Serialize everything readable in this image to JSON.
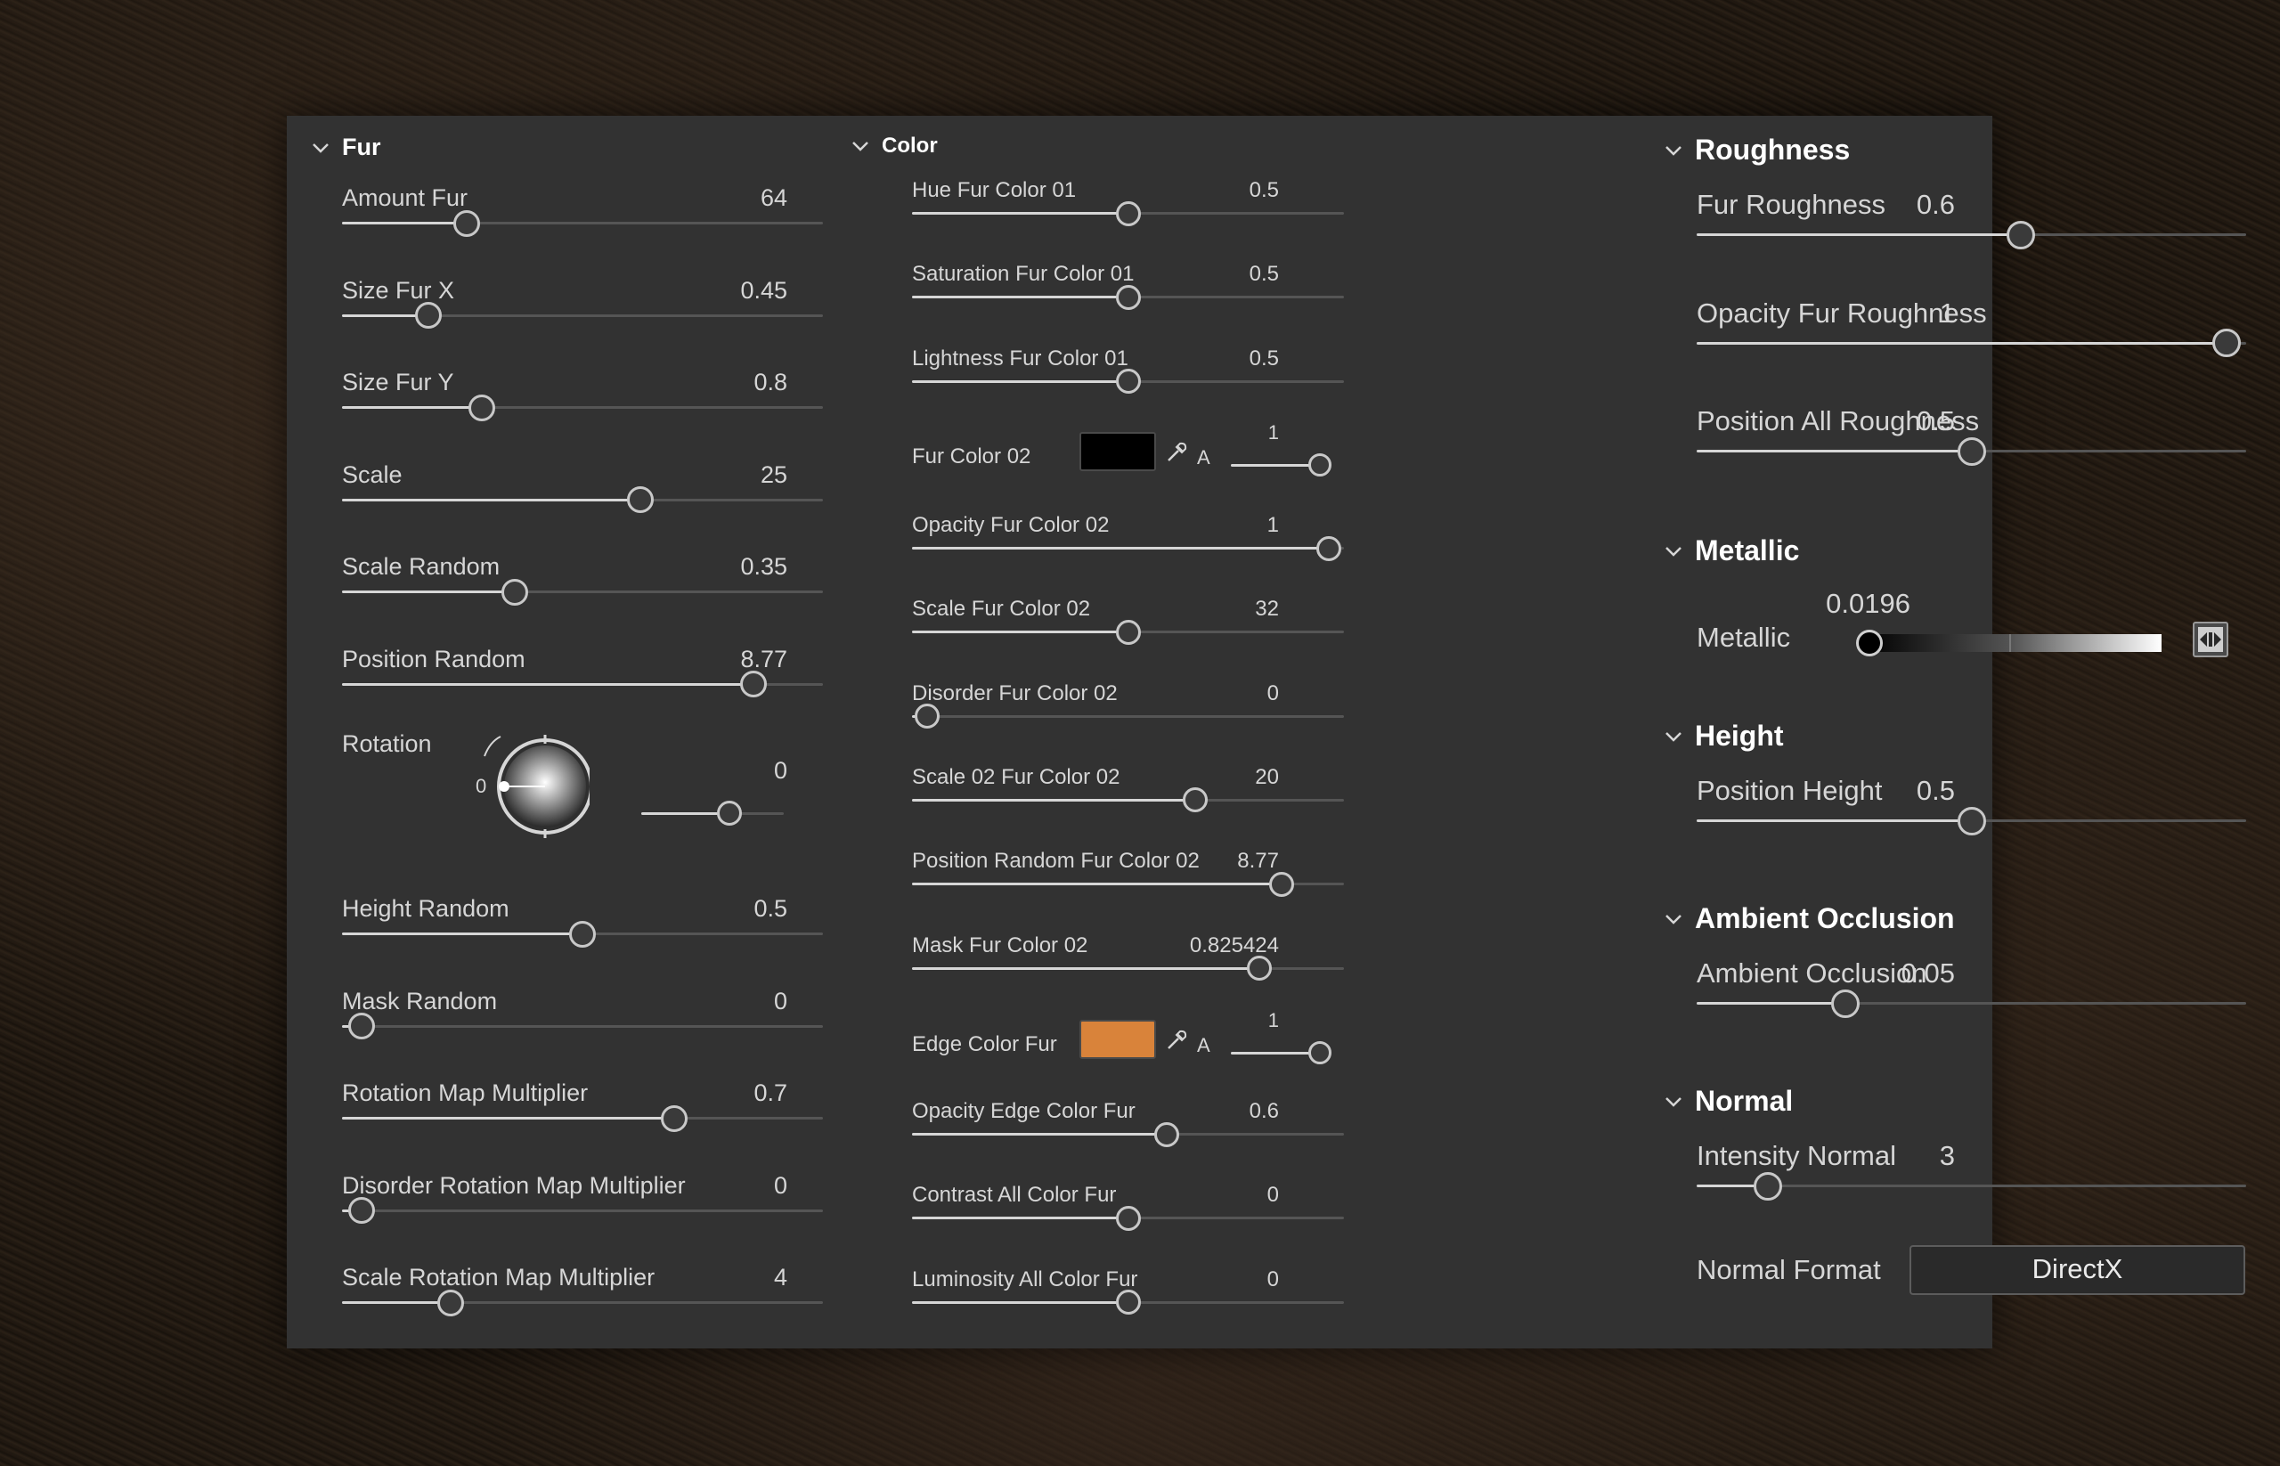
{
  "sections": {
    "fur": {
      "title": "Fur",
      "params": [
        {
          "label": "Amount Fur",
          "value": "64",
          "ratio": 0.26
        },
        {
          "label": "Size Fur X",
          "value": "0.45",
          "ratio": 0.18
        },
        {
          "label": "Size Fur Y",
          "value": "0.8",
          "ratio": 0.29
        },
        {
          "label": "Scale",
          "value": "25",
          "ratio": 0.62
        },
        {
          "label": "Scale Random",
          "value": "0.35",
          "ratio": 0.36
        },
        {
          "label": "Position Random",
          "value": "8.77",
          "ratio": 0.855
        }
      ],
      "rotation": {
        "label": "Rotation",
        "value": "0",
        "knob_label": "0",
        "ratio": 0.62
      },
      "params2": [
        {
          "label": "Height Random",
          "value": "0.5",
          "ratio": 0.5
        },
        {
          "label": "Mask Random",
          "value": "0",
          "ratio": 0.04
        },
        {
          "label": "Rotation Map Multiplier",
          "value": "0.7",
          "ratio": 0.69
        },
        {
          "label": "Disorder Rotation Map Multiplier",
          "value": "0",
          "ratio": 0.04
        },
        {
          "label": "Scale Rotation Map Multiplier",
          "value": "4",
          "ratio": 0.225
        }
      ]
    },
    "color": {
      "title": "Color",
      "params": [
        {
          "label": "Hue Fur Color 01",
          "value": "0.5",
          "ratio": 0.5
        },
        {
          "label": "Saturation Fur Color 01",
          "value": "0.5",
          "ratio": 0.5
        },
        {
          "label": "Lightness Fur Color 01",
          "value": "0.5",
          "ratio": 0.5
        }
      ],
      "fur_color_02": {
        "label": "Fur Color 02",
        "color": "#000000",
        "alpha_label": "A",
        "alpha_value": "1",
        "ratio": 1.0
      },
      "params2": [
        {
          "label": "Opacity Fur Color 02",
          "value": "1",
          "ratio": 0.965
        },
        {
          "label": "Scale Fur Color 02",
          "value": "32",
          "ratio": 0.5
        },
        {
          "label": "Disorder Fur Color 02",
          "value": "0",
          "ratio": 0.035
        },
        {
          "label": "Scale 02 Fur Color 02",
          "value": "20",
          "ratio": 0.655
        },
        {
          "label": "Position Random Fur Color 02",
          "value": "8.77",
          "ratio": 0.855
        },
        {
          "label": "Mask Fur Color 02",
          "value": "0.825424",
          "ratio": 0.805
        }
      ],
      "edge_color_fur": {
        "label": "Edge Color Fur",
        "color": "#d9833a",
        "alpha_label": "A",
        "alpha_value": "1",
        "ratio": 1.0
      },
      "params3": [
        {
          "label": "Opacity Edge Color Fur",
          "value": "0.6",
          "ratio": 0.59
        },
        {
          "label": "Contrast All Color Fur",
          "value": "0",
          "ratio": 0.5
        },
        {
          "label": "Luminosity All Color Fur",
          "value": "0",
          "ratio": 0.5
        }
      ]
    },
    "roughness": {
      "title": "Roughness",
      "params": [
        {
          "label": "Fur Roughness",
          "value": "0.6",
          "ratio": 0.59
        },
        {
          "label": "Opacity Fur Roughness",
          "value": "1",
          "ratio": 0.965
        },
        {
          "label": "Position All Roughness",
          "value": "0.5",
          "ratio": 0.5
        }
      ]
    },
    "metallic": {
      "title": "Metallic",
      "param": {
        "label": "Metallic",
        "value": "0.0196",
        "ratio": 0.02
      }
    },
    "height": {
      "title": "Height",
      "params": [
        {
          "label": "Position Height",
          "value": "0.5",
          "ratio": 0.5
        }
      ]
    },
    "ambient_occlusion": {
      "title": "Ambient Occlusion",
      "params": [
        {
          "label": "Ambient Occlusion",
          "value": "0.05",
          "ratio": 0.27
        }
      ]
    },
    "normal": {
      "title": "Normal",
      "params": [
        {
          "label": "Intensity Normal",
          "value": "3",
          "ratio": 0.13
        }
      ],
      "format_label": "Normal Format",
      "format_value": "DirectX"
    }
  },
  "colors": {
    "panel_bg": "#323232",
    "text": "#d6d6d6",
    "header_text": "#ffffff",
    "track": "#555555",
    "track_fill": "#d6d6d6",
    "thumb_border": "#c8c8c8"
  },
  "icons": {
    "section_toggle": "chevron-down-icon",
    "color_picker": "eyedropper-icon",
    "metallic_toggle": "binary-switch-icon",
    "rotation_knob": "rotation-dial-icon"
  }
}
